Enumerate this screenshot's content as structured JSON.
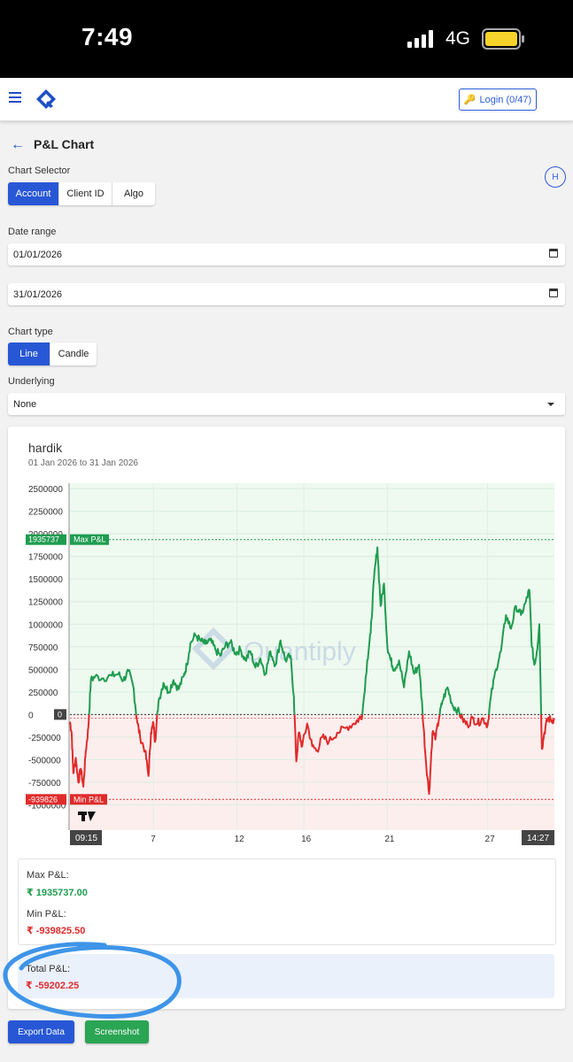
{
  "status_bar": {
    "time": "7:49",
    "network": "4G"
  },
  "header": {
    "login_label": "Login (0/47)",
    "avatar_initial": "H"
  },
  "page": {
    "title": "P&L Chart"
  },
  "chart_selector": {
    "label": "Chart Selector",
    "options": [
      "Account",
      "Client ID",
      "Algo"
    ],
    "selected": "Account"
  },
  "date_range": {
    "label": "Date range",
    "start": "01/01/2026",
    "end": "31/01/2026"
  },
  "chart_type": {
    "label": "Chart type",
    "options": [
      "Line",
      "Candle"
    ],
    "selected": "Line"
  },
  "underlying": {
    "label": "Underlying",
    "value": "None"
  },
  "chart_card": {
    "name": "hardik",
    "range": "01 Jan 2026 to 31 Jan 2026",
    "watermark": "Quantiply",
    "max_tag": "1935737",
    "max_tag_label": "Max P&L",
    "min_tag": "-939826",
    "min_tag_label": "Min P&L",
    "zero_tag": "0",
    "time_start": "09:15",
    "time_end": "14:27"
  },
  "chart_data": {
    "type": "line",
    "y_ticks": [
      2500000,
      2250000,
      2000000,
      1750000,
      1500000,
      1250000,
      1000000,
      750000,
      500000,
      250000,
      0,
      -250000,
      -500000,
      -750000,
      -1000000
    ],
    "y_tick_labels": [
      "2500000",
      "2250000",
      "2000000",
      "1750000",
      "1500000",
      "1250000",
      "1000000",
      "750000",
      "500000",
      "250000",
      "0",
      "-250000",
      "-500000",
      "-750000",
      "-1000000"
    ],
    "ylim": [
      -1280000,
      2560000
    ],
    "x_tick_labels": [
      "7",
      "12",
      "16",
      "21",
      "27"
    ],
    "x_tick_days": [
      7,
      12,
      16,
      21,
      27
    ],
    "xlim": [
      2,
      31
    ],
    "positive_color": "#1e9c4f",
    "negative_color": "#e02b2b",
    "max_pnl": 1935737,
    "min_pnl": -939826,
    "points": [
      [
        2.0,
        -80000
      ],
      [
        2.1,
        -200000
      ],
      [
        2.2,
        -650000
      ],
      [
        2.35,
        -480000
      ],
      [
        2.5,
        -750000
      ],
      [
        2.65,
        -600000
      ],
      [
        2.8,
        -800000
      ],
      [
        2.95,
        -400000
      ],
      [
        3.1,
        -150000
      ],
      [
        3.25,
        380000
      ],
      [
        3.5,
        420000
      ],
      [
        4.0,
        400000
      ],
      [
        4.5,
        430000
      ],
      [
        4.9,
        450000
      ],
      [
        5.2,
        380000
      ],
      [
        5.5,
        480000
      ],
      [
        5.8,
        300000
      ],
      [
        6.0,
        -50000
      ],
      [
        6.2,
        -250000
      ],
      [
        6.5,
        -400000
      ],
      [
        6.7,
        -680000
      ],
      [
        6.85,
        -200000
      ],
      [
        7.0,
        -100000
      ],
      [
        7.1,
        -300000
      ],
      [
        7.3,
        150000
      ],
      [
        7.6,
        350000
      ],
      [
        7.9,
        250000
      ],
      [
        8.2,
        380000
      ],
      [
        8.5,
        280000
      ],
      [
        8.8,
        420000
      ],
      [
        9.0,
        550000
      ],
      [
        9.2,
        780000
      ],
      [
        9.5,
        880000
      ],
      [
        9.8,
        820000
      ],
      [
        10.1,
        780000
      ],
      [
        10.4,
        820000
      ],
      [
        10.7,
        720000
      ],
      [
        11.0,
        650000
      ],
      [
        11.3,
        760000
      ],
      [
        11.6,
        800000
      ],
      [
        11.9,
        680000
      ],
      [
        12.2,
        720000
      ],
      [
        12.5,
        600000
      ],
      [
        12.8,
        700000
      ],
      [
        13.1,
        520000
      ],
      [
        13.4,
        620000
      ],
      [
        13.7,
        450000
      ],
      [
        14.0,
        700000
      ],
      [
        14.3,
        550000
      ],
      [
        14.6,
        820000
      ],
      [
        14.9,
        600000
      ],
      [
        15.2,
        650000
      ],
      [
        15.4,
        200000
      ],
      [
        15.55,
        -520000
      ],
      [
        15.7,
        -200000
      ],
      [
        15.9,
        -350000
      ],
      [
        16.2,
        -100000
      ],
      [
        16.5,
        -350000
      ],
      [
        16.8,
        -400000
      ],
      [
        17.1,
        -250000
      ],
      [
        17.5,
        -300000
      ],
      [
        18.0,
        -200000
      ],
      [
        18.5,
        -150000
      ],
      [
        19.0,
        -100000
      ],
      [
        19.3,
        -50000
      ],
      [
        19.5,
        0
      ],
      [
        19.8,
        600000
      ],
      [
        20.0,
        900000
      ],
      [
        20.2,
        1500000
      ],
      [
        20.4,
        1850000
      ],
      [
        20.6,
        1200000
      ],
      [
        20.8,
        1450000
      ],
      [
        21.0,
        750000
      ],
      [
        21.2,
        600000
      ],
      [
        21.4,
        500000
      ],
      [
        21.7,
        600000
      ],
      [
        22.0,
        300000
      ],
      [
        22.3,
        700000
      ],
      [
        22.6,
        450000
      ],
      [
        22.9,
        550000
      ],
      [
        23.1,
        50000
      ],
      [
        23.3,
        -500000
      ],
      [
        23.5,
        -880000
      ],
      [
        23.7,
        -200000
      ],
      [
        23.9,
        -250000
      ],
      [
        24.1,
        -30000
      ],
      [
        24.3,
        150000
      ],
      [
        24.6,
        300000
      ],
      [
        24.9,
        100000
      ],
      [
        25.2,
        50000
      ],
      [
        25.5,
        -50000
      ],
      [
        25.8,
        -120000
      ],
      [
        26.1,
        -40000
      ],
      [
        26.4,
        -100000
      ],
      [
        26.7,
        -40000
      ],
      [
        27.0,
        -120000
      ],
      [
        27.2,
        200000
      ],
      [
        27.5,
        500000
      ],
      [
        27.8,
        700000
      ],
      [
        28.1,
        1100000
      ],
      [
        28.4,
        950000
      ],
      [
        28.7,
        1200000
      ],
      [
        29.0,
        1100000
      ],
      [
        29.3,
        1250000
      ],
      [
        29.5,
        1380000
      ],
      [
        29.65,
        750000
      ],
      [
        29.8,
        550000
      ],
      [
        29.95,
        700000
      ],
      [
        30.1,
        1000000
      ],
      [
        30.25,
        -380000
      ],
      [
        30.4,
        -200000
      ],
      [
        30.6,
        -40000
      ],
      [
        30.8,
        -60000
      ],
      [
        31.0,
        -60000
      ]
    ]
  },
  "stats": {
    "max_label": "Max P&L:",
    "max_value": "₹ 1935737.00",
    "min_label": "Min P&L:",
    "min_value": "₹ -939825.50",
    "total_label": "Total P&L:",
    "total_value": "₹ -59202.25"
  },
  "actions": {
    "export_label": "Export Data",
    "screenshot_label": "Screenshot"
  },
  "colors": {
    "primary": "#2857d6",
    "positive": "#1e9c4f",
    "negative": "#e02b2b",
    "annotation": "#2a8ae6"
  }
}
